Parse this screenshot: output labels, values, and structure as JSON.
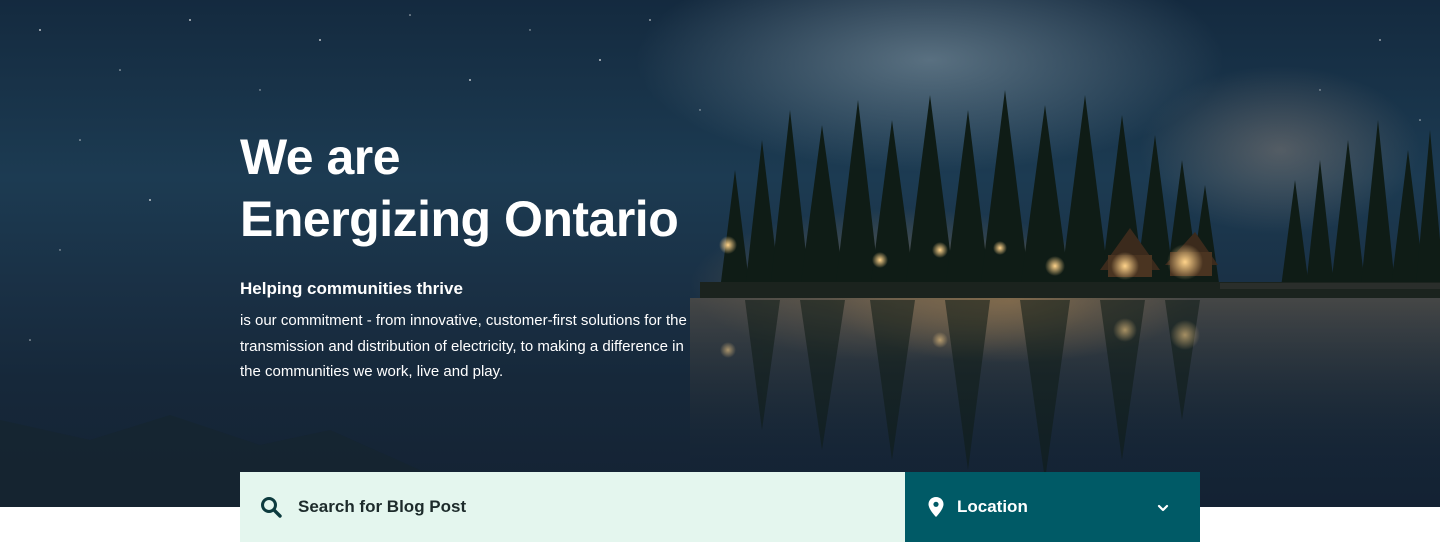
{
  "hero": {
    "title_line1": "We are",
    "title_line2": "Energizing Ontario",
    "subtitle": "Helping communities thrive",
    "description": "is our commitment - from innovative, customer-first solutions for the transmission and distribution of electricity, to making a difference in the communities we work, live and play."
  },
  "search": {
    "placeholder": "Search for Blog Post",
    "icon": "search-icon"
  },
  "location": {
    "label": "Location",
    "icon": "map-pin-icon",
    "dropdown_icon": "chevron-down-icon"
  },
  "colors": {
    "search_bg": "#e4f6ee",
    "location_bg": "#005a66",
    "text_dark": "#1d2b2b",
    "hero_text": "#ffffff"
  }
}
